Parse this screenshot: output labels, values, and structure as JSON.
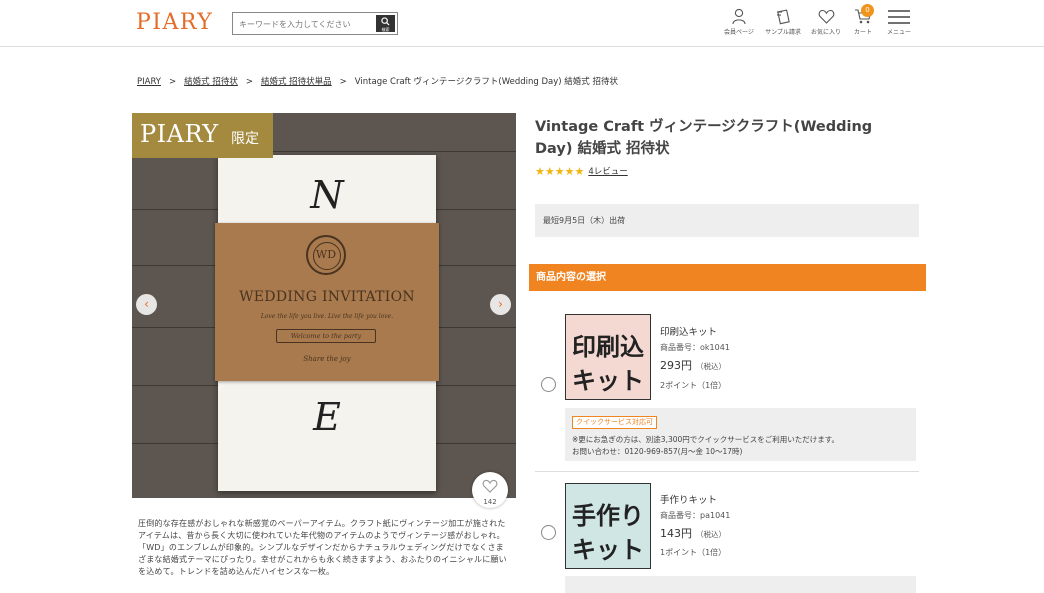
{
  "header": {
    "logo": "PIARY",
    "search_placeholder": "キーワードを入力してください",
    "search_button": "検索",
    "nav": [
      {
        "label": "会員ページ",
        "icon": "user-icon"
      },
      {
        "label": "サンプル請求",
        "icon": "sample-icon"
      },
      {
        "label": "お気に入り",
        "icon": "heart-icon"
      },
      {
        "label": "カート",
        "icon": "cart-icon",
        "badge": "0"
      },
      {
        "label": "メニュー",
        "icon": "hamburger-icon"
      }
    ]
  },
  "breadcrumb": [
    "PIARY",
    "結婚式 招待状",
    "結婚式 招待状単品",
    "Vintage Craft ヴィンテージクラフト(Wedding Day) 結婚式 招待状"
  ],
  "breadcrumb_sep": ">",
  "gallery": {
    "badge_main": "PIARY",
    "badge_sub": "限定",
    "card": {
      "top_initial": "N",
      "bottom_initial": "E",
      "seal": "WD",
      "title": "WEDDING INVITATION",
      "script_line": "Love the life you live. Live the life you love.",
      "ribbon": "Welcome to the party",
      "sub": "Share the joy"
    },
    "prev": "‹",
    "next": "›",
    "favorite_count": "142"
  },
  "description": "圧倒的な存在感がおしゃれな新感覚のペーパーアイテム。クラフト紙にヴィンテージ加工が施されたアイテムは、昔から長く大切に使われていた年代物のアイテムのようでヴィンテージ感がおしゃれ。「WD」のエンブレムが印象的。シンプルなデザインだからナチュラルウェディングだけでなくさまざまな結婚式テーマにぴったり。幸せがこれからも永く続きますよう、おふたりのイニシャルに願いを込めて。トレンドを詰め込んだハイセンスな一枚。",
  "product": {
    "title": "Vintage Craft ヴィンテージクラフト(Wedding Day) 結婚式 招待状",
    "stars": "★★★★★",
    "reviews": "4レビュー",
    "shipping": "最短9月5日（木）出荷"
  },
  "selection": {
    "heading": "商品内容の選択",
    "options": [
      {
        "img_line1": "印刷込",
        "img_line2": "キット",
        "name": "印刷込キット",
        "code": "商品番号：ok1041",
        "price": "293円",
        "tax": "（税込）",
        "points": "2ポイント（1倍）",
        "img_bg": "#f4d9d3"
      },
      {
        "img_line1": "手作り",
        "img_line2": "キット",
        "name": "手作りキット",
        "code": "商品番号：pa1041",
        "price": "143円",
        "tax": "（税込）",
        "points": "1ポイント（1倍）",
        "img_bg": "#cfe6e4"
      }
    ],
    "quick": {
      "tag": "クイックサービス対応可",
      "line1": "※更にお急ぎの方は、別途3,300円でクイックサービスをご利用いただけます。",
      "line2": "お問い合わせ：0120-969-857(月〜金 10〜17時)"
    }
  }
}
